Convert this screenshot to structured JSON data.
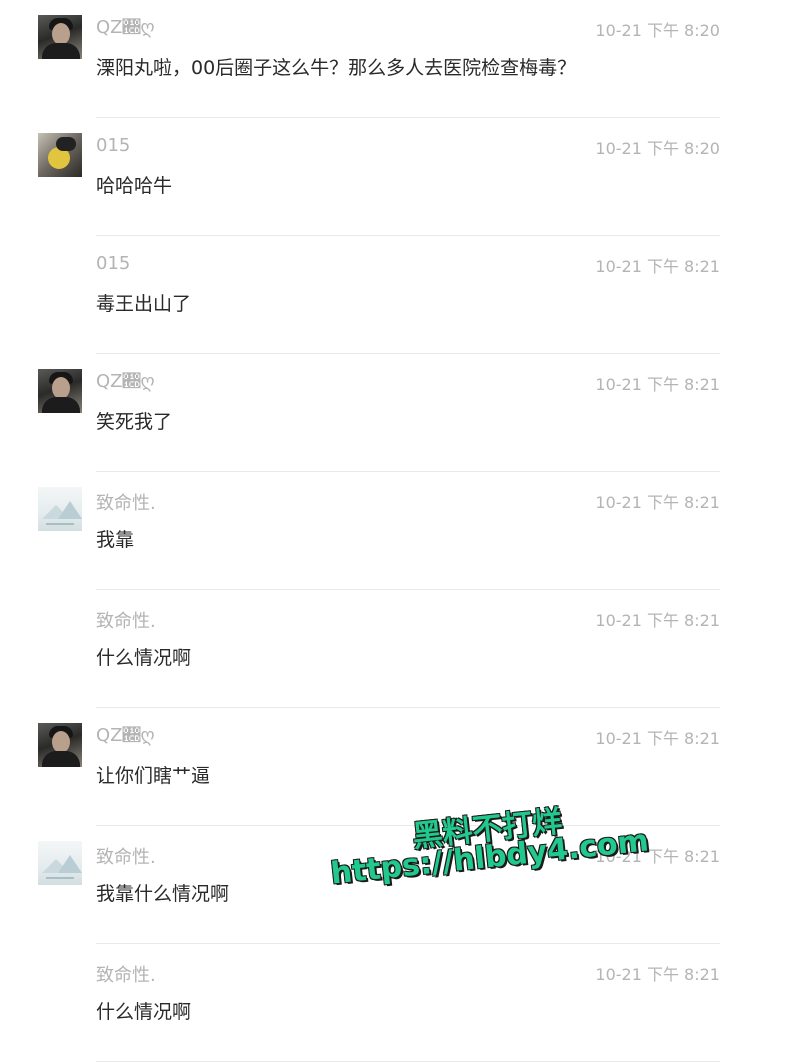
{
  "comments": [
    {
      "avatar": "avatar-a",
      "name": "QZ𐇍ღ",
      "time": "10-21 下午 8:20",
      "text": "溧阳丸啦，00后圈子这么牛？那么多人去医院检查梅毒？"
    },
    {
      "avatar": "avatar-b",
      "name": "015",
      "time": "10-21 下午 8:20",
      "text": "哈哈哈牛"
    },
    {
      "avatar": "none",
      "name": "015",
      "time": "10-21 下午 8:21",
      "text": "毒王出山了"
    },
    {
      "avatar": "avatar-a",
      "name": "QZ𐇍ღ",
      "time": "10-21 下午 8:21",
      "text": "笑死我了"
    },
    {
      "avatar": "avatar-c",
      "name": "致命性.",
      "time": "10-21 下午 8:21",
      "text": "我靠"
    },
    {
      "avatar": "none",
      "name": "致命性.",
      "time": "10-21 下午 8:21",
      "text": "什么情况啊"
    },
    {
      "avatar": "avatar-a",
      "name": "QZ𐇍ღ",
      "time": "10-21 下午 8:21",
      "text": "让你们瞎艹逼"
    },
    {
      "avatar": "avatar-c",
      "name": "致命性.",
      "time": "10-21 下午 8:21",
      "text": "我靠什么情况啊"
    },
    {
      "avatar": "none",
      "name": "致命性.",
      "time": "10-21 下午 8:21",
      "text": "什么情况啊"
    }
  ],
  "watermark": {
    "line1": "黑料不打烊",
    "line2": "https://hlbdy4.com",
    "color": "#22c98f"
  }
}
